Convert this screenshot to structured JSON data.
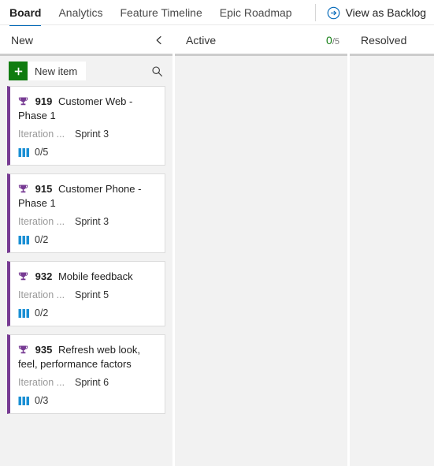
{
  "pivot": {
    "tabs": [
      {
        "label": "Board",
        "selected": true
      },
      {
        "label": "Analytics",
        "selected": false
      },
      {
        "label": "Feature Timeline",
        "selected": false
      },
      {
        "label": "Epic Roadmap",
        "selected": false
      }
    ],
    "action": {
      "label": "View as Backlog",
      "icon": "circle-arrow-right-icon"
    },
    "accent_color": "#0067b8"
  },
  "toolbar": {
    "new_item_label": "New item",
    "new_item_icon": "plus-icon",
    "new_item_color": "#107c10",
    "search_icon": "search-icon"
  },
  "columns": [
    {
      "name": "New",
      "wip_current": "",
      "wip_limit": "",
      "collapse_icon": "chevron-left-icon",
      "has_toolbar": true
    },
    {
      "name": "Active",
      "wip_current": "0",
      "wip_limit": "/5",
      "collapse_icon": "",
      "has_toolbar": false
    },
    {
      "name": "Resolved",
      "wip_current": "",
      "wip_limit": "",
      "collapse_icon": "",
      "has_toolbar": false
    }
  ],
  "cards": [
    {
      "id": "919",
      "title": "Customer Web - Phase 1",
      "type_icon": "trophy-icon",
      "type_color": "#773b93",
      "field_label": "Iteration ...",
      "field_value": "Sprint 3",
      "progress_icon": "progress-bars-icon",
      "progress_text": "0/5"
    },
    {
      "id": "915",
      "title": "Customer Phone - Phase 1",
      "type_icon": "trophy-icon",
      "type_color": "#773b93",
      "field_label": "Iteration ...",
      "field_value": "Sprint 3",
      "progress_icon": "progress-bars-icon",
      "progress_text": "0/2"
    },
    {
      "id": "932",
      "title": "Mobile feedback",
      "type_icon": "trophy-icon",
      "type_color": "#773b93",
      "field_label": "Iteration ...",
      "field_value": "Sprint 5",
      "progress_icon": "progress-bars-icon",
      "progress_text": "0/2"
    },
    {
      "id": "935",
      "title": "Refresh web look, feel, performance factors",
      "type_icon": "trophy-icon",
      "type_color": "#773b93",
      "field_label": "Iteration ...",
      "field_value": "Sprint 6",
      "progress_icon": "progress-bars-icon",
      "progress_text": "0/3"
    }
  ]
}
